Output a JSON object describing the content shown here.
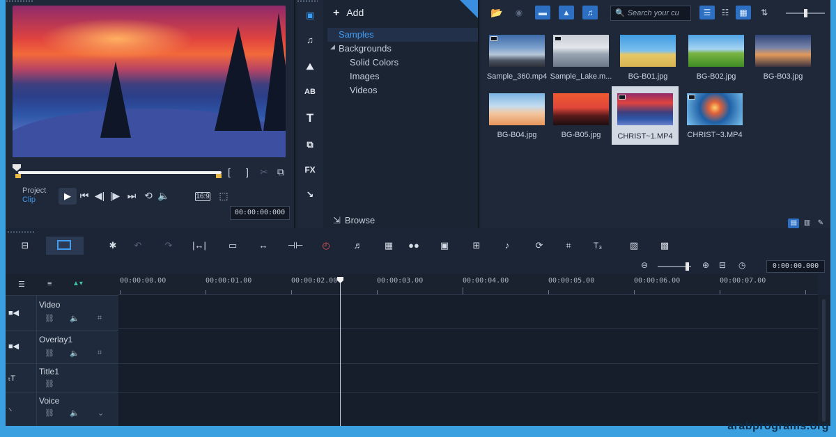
{
  "preview": {
    "project_label": "Project",
    "clip_label": "Clip",
    "timecode": "00:00:00:000"
  },
  "library": {
    "add_label": "Add",
    "folders": [
      "Samples",
      "Backgrounds",
      "Solid Colors",
      "Images",
      "Videos"
    ],
    "browse_label": "Browse",
    "search_placeholder": "Search your cu",
    "thumbnails": [
      {
        "caption": "Sample_360.mp4",
        "video": true,
        "selected": false
      },
      {
        "caption": "Sample_Lake.m...",
        "video": true,
        "selected": false
      },
      {
        "caption": "BG-B01.jpg",
        "video": false,
        "selected": false
      },
      {
        "caption": "BG-B02.jpg",
        "video": false,
        "selected": false
      },
      {
        "caption": "BG-B03.jpg",
        "video": false,
        "selected": false
      },
      {
        "caption": "BG-B04.jpg",
        "video": false,
        "selected": false
      },
      {
        "caption": "BG-B05.jpg",
        "video": false,
        "selected": false
      },
      {
        "caption": "CHRIST~1.MP4",
        "video": true,
        "selected": true
      },
      {
        "caption": "CHRIST~3.MP4",
        "video": true,
        "selected": false
      }
    ]
  },
  "timeline": {
    "time": "0:00:00.000",
    "ruler": [
      "00:00:00.00",
      "00:00:01.00",
      "00:00:02.00",
      "00:00:03.00",
      "00:00:04.00",
      "00:00:05.00",
      "00:00:06.00",
      "00:00:07.00"
    ],
    "tracks": [
      {
        "name": "Video",
        "icon": "video-camera-icon"
      },
      {
        "name": "Overlay1",
        "icon": "video-camera-icon"
      },
      {
        "name": "Title1",
        "icon": "title-t-icon"
      },
      {
        "name": "Voice",
        "icon": "microphone-icon"
      }
    ]
  },
  "watermark": "arabprograms.org",
  "colors": {
    "accent": "#3e9cf2",
    "panel": "#1e2839",
    "frame": "#3aa0e0"
  }
}
